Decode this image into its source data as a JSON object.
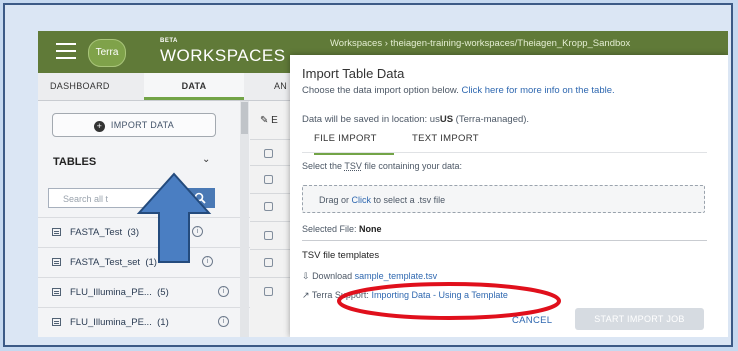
{
  "header": {
    "logo_text": "Terra",
    "beta_label": "BETA",
    "app_title": "WORKSPACES",
    "breadcrumb": "Workspaces › theiagen-training-workspaces/Theiagen_Kropp_Sandbox"
  },
  "tabs": [
    {
      "label": "DASHBOARD"
    },
    {
      "label": "DATA"
    },
    {
      "label": "AN"
    }
  ],
  "sidebar": {
    "import_button": "IMPORT DATA",
    "tables_heading": "TABLES",
    "search_placeholder": "Search all t",
    "tables": [
      {
        "name": "FASTA_Test",
        "count": "(3)"
      },
      {
        "name": "FASTA_Test_set",
        "count": "(1)"
      },
      {
        "name": "FLU_Illumina_PE...",
        "count": "(5)"
      },
      {
        "name": "FLU_Illumina_PE...",
        "count": "(1)"
      }
    ]
  },
  "main": {
    "edit_partial": "E"
  },
  "modal": {
    "title": "Import Table Data",
    "intro": "Choose the data import option below.",
    "intro_link": "Click here for more info on the table.",
    "location_prefix": "Data will be saved in location: us",
    "location_value": "US",
    "location_suffix": "(Terra-managed).",
    "tab_file": "FILE IMPORT",
    "tab_text": "TEXT IMPORT",
    "select_prefix": "Select the",
    "select_tsv": "TSV",
    "select_suffix": "file containing your data:",
    "drop_prefix": "Drag or",
    "drop_link": "Click",
    "drop_suffix": "to select a .tsv file",
    "selected_label": "Selected File:",
    "selected_value": "None",
    "templates_heading": "TSV file templates",
    "download_prefix": "Download",
    "download_link": "sample_template.tsv",
    "support_prefix": "Terra Support:",
    "support_link": "Importing Data - Using a Template",
    "cancel_label": "CANCEL",
    "start_label": "START IMPORT JOB"
  },
  "colors": {
    "header_green": "#607a38",
    "accent_green": "#73a447",
    "link_blue": "#2f68b0",
    "annotation_red": "#e0101c",
    "annotation_arrow": "#4a7ec2"
  }
}
